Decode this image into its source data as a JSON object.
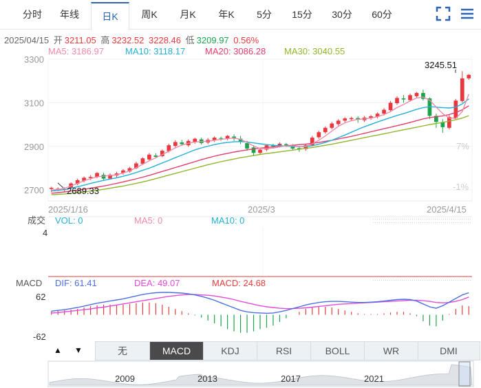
{
  "tabs": [
    "分时",
    "年线",
    "日K",
    "周K",
    "月K",
    "年K",
    "5分",
    "15分",
    "30分",
    "60分"
  ],
  "active_tab": "日K",
  "icons": {
    "fullscreen": "fullscreen-icon",
    "menu": "menu-icon"
  },
  "info": {
    "date": "2025/04/15",
    "open_label": "开",
    "open": "3211.05",
    "high_label": "高",
    "high": "3232.52",
    "close": "3228.46",
    "low_label": "低",
    "low": "3209.97",
    "change": "0.56%"
  },
  "ma_labels": {
    "ma5": "MA5: 3186.97",
    "ma10": "MA10: 3118.17",
    "ma20": "MA20: 3086.28",
    "ma30": "MA30: 3040.55"
  },
  "colors": {
    "up": "#e8383d",
    "down": "#1aa34a",
    "ma5": "#f08aa8",
    "ma10": "#22b0d6",
    "ma20": "#e23c6a",
    "ma30": "#8fb62a",
    "dif": "#4b6fe0",
    "dea": "#e04bd8",
    "grid": "#eef0f3"
  },
  "price_axis": {
    "ticks": [
      "3300",
      "3100",
      "2900",
      "2700"
    ],
    "pct_ticks": [
      "7%",
      "-1%"
    ]
  },
  "date_axis": [
    "2025/1/16",
    "2025/3",
    "2025/4/15"
  ],
  "markers": {
    "max": "3245.51",
    "min": "2689.33"
  },
  "volume": {
    "title": "成交",
    "vol": "VOL: 0",
    "ma5": "MA5: 0",
    "ma10": "MA10: 0",
    "tick": "4"
  },
  "macd": {
    "title": "MACD",
    "dif": "DIF: 61.41",
    "dea": "DEA: 49.07",
    "macd": "MACD: 24.68",
    "top": "62",
    "bottom": "-62"
  },
  "bottom_tabs": [
    "无",
    "MACD",
    "KDJ",
    "RSI",
    "BOLL",
    "WR",
    "DMI"
  ],
  "active_bottom": "MACD",
  "nav_arrows": [
    "▲",
    "▼"
  ],
  "overview_years": [
    "2009",
    "2013",
    "2017",
    "2021"
  ],
  "chart_data": {
    "type": "candlestick",
    "ylim": [
      2650,
      3300
    ],
    "candles": [
      [
        2705,
        2710,
        2690,
        2715
      ],
      [
        2702,
        2706,
        2695,
        2712
      ],
      [
        2700,
        2705,
        2689,
        2712
      ],
      [
        2710,
        2730,
        2705,
        2735
      ],
      [
        2728,
        2745,
        2722,
        2752
      ],
      [
        2742,
        2756,
        2735,
        2762
      ],
      [
        2755,
        2760,
        2746,
        2768
      ],
      [
        2760,
        2778,
        2754,
        2782
      ],
      [
        2770,
        2752,
        2745,
        2780
      ],
      [
        2752,
        2770,
        2748,
        2776
      ],
      [
        2766,
        2776,
        2758,
        2783
      ],
      [
        2778,
        2790,
        2770,
        2796
      ],
      [
        2785,
        2800,
        2780,
        2806
      ],
      [
        2800,
        2822,
        2795,
        2830
      ],
      [
        2820,
        2845,
        2815,
        2850
      ],
      [
        2840,
        2862,
        2835,
        2870
      ],
      [
        2858,
        2852,
        2845,
        2868
      ],
      [
        2855,
        2880,
        2850,
        2886
      ],
      [
        2878,
        2905,
        2872,
        2912
      ],
      [
        2902,
        2920,
        2895,
        2928
      ],
      [
        2918,
        2910,
        2902,
        2930
      ],
      [
        2905,
        2925,
        2898,
        2932
      ],
      [
        2920,
        2935,
        2912,
        2940
      ],
      [
        2932,
        2915,
        2908,
        2940
      ],
      [
        2918,
        2930,
        2910,
        2938
      ],
      [
        2928,
        2940,
        2920,
        2946
      ],
      [
        2938,
        2935,
        2926,
        2944
      ],
      [
        2935,
        2948,
        2928,
        2952
      ],
      [
        2945,
        2935,
        2925,
        2955
      ],
      [
        2935,
        2920,
        2910,
        2948
      ],
      [
        2915,
        2890,
        2880,
        2925
      ],
      [
        2895,
        2870,
        2855,
        2905
      ],
      [
        2870,
        2885,
        2862,
        2892
      ],
      [
        2885,
        2905,
        2878,
        2910
      ],
      [
        2905,
        2900,
        2892,
        2912
      ],
      [
        2900,
        2912,
        2895,
        2918
      ],
      [
        2910,
        2905,
        2898,
        2916
      ],
      [
        2900,
        2890,
        2882,
        2910
      ],
      [
        2892,
        2888,
        2875,
        2900
      ],
      [
        2888,
        2905,
        2880,
        2910
      ],
      [
        2905,
        2940,
        2900,
        2948
      ],
      [
        2942,
        2965,
        2935,
        2972
      ],
      [
        2965,
        2985,
        2958,
        2992
      ],
      [
        2985,
        3005,
        2978,
        3012
      ],
      [
        3002,
        3018,
        2995,
        3025
      ],
      [
        3018,
        3028,
        3010,
        3034
      ],
      [
        3025,
        3030,
        3018,
        3036
      ],
      [
        3030,
        3022,
        3008,
        3038
      ],
      [
        3020,
        3032,
        3012,
        3040
      ],
      [
        3030,
        3038,
        3022,
        3044
      ],
      [
        3036,
        3050,
        3028,
        3056
      ],
      [
        3050,
        3068,
        3042,
        3075
      ],
      [
        3066,
        3100,
        3060,
        3108
      ],
      [
        3098,
        3122,
        3090,
        3130
      ],
      [
        3120,
        3115,
        3100,
        3135
      ],
      [
        3112,
        3135,
        3105,
        3142
      ],
      [
        3130,
        3145,
        3122,
        3150
      ],
      [
        3145,
        3118,
        3110,
        3160
      ],
      [
        3120,
        3040,
        3025,
        3125
      ],
      [
        3040,
        3012,
        2985,
        3050
      ],
      [
        3012,
        2988,
        2962,
        3025
      ],
      [
        2985,
        3035,
        2978,
        3045
      ],
      [
        3030,
        3110,
        3025,
        3118
      ],
      [
        3108,
        3212,
        3100,
        3245
      ],
      [
        3212,
        3228,
        3205,
        3232
      ]
    ],
    "ma5": [
      2700,
      2702,
      2708,
      2718,
      2730,
      2742,
      2752,
      2760,
      2764,
      2766,
      2770,
      2778,
      2788,
      2802,
      2818,
      2834,
      2848,
      2862,
      2878,
      2893,
      2906,
      2914,
      2920,
      2922,
      2924,
      2928,
      2932,
      2936,
      2938,
      2932,
      2918,
      2902,
      2890,
      2890,
      2892,
      2898,
      2902,
      2902,
      2900,
      2900,
      2912,
      2928,
      2948,
      2970,
      2992,
      3008,
      3018,
      3024,
      3026,
      3030,
      3036,
      3046,
      3060,
      3078,
      3092,
      3108,
      3122,
      3126,
      3112,
      3080,
      3050,
      3030,
      3028,
      3060,
      3140
    ],
    "ma10": [
      2695,
      2698,
      2702,
      2708,
      2715,
      2722,
      2730,
      2737,
      2744,
      2750,
      2756,
      2763,
      2771,
      2780,
      2790,
      2800,
      2812,
      2824,
      2836,
      2848,
      2860,
      2872,
      2884,
      2893,
      2901,
      2908,
      2914,
      2918,
      2921,
      2922,
      2920,
      2916,
      2912,
      2908,
      2905,
      2903,
      2901,
      2900,
      2899,
      2899,
      2903,
      2910,
      2918,
      2928,
      2940,
      2952,
      2965,
      2978,
      2990,
      3001,
      3012,
      3022,
      3032,
      3042,
      3050,
      3060,
      3070,
      3078,
      3082,
      3080,
      3078,
      3076,
      3080,
      3095,
      3118
    ],
    "ma20": [
      2685,
      2688,
      2691,
      2695,
      2699,
      2703,
      2708,
      2713,
      2718,
      2724,
      2730,
      2737,
      2744,
      2751,
      2759,
      2767,
      2776,
      2785,
      2794,
      2803,
      2812,
      2821,
      2830,
      2839,
      2847,
      2855,
      2862,
      2868,
      2874,
      2879,
      2884,
      2888,
      2892,
      2895,
      2898,
      2900,
      2903,
      2905,
      2908,
      2910,
      2914,
      2918,
      2923,
      2928,
      2934,
      2940,
      2946,
      2953,
      2960,
      2967,
      2974,
      2981,
      2988,
      2995,
      3002,
      3010,
      3018,
      3026,
      3032,
      3036,
      3040,
      3046,
      3055,
      3068,
      3086
    ],
    "ma30": [
      2678,
      2680,
      2682,
      2685,
      2688,
      2691,
      2695,
      2699,
      2703,
      2708,
      2713,
      2718,
      2724,
      2730,
      2737,
      2744,
      2752,
      2760,
      2768,
      2776,
      2784,
      2792,
      2800,
      2808,
      2816,
      2823,
      2830,
      2836,
      2842,
      2848,
      2853,
      2858,
      2863,
      2867,
      2871,
      2875,
      2879,
      2883,
      2887,
      2891,
      2895,
      2900,
      2905,
      2910,
      2916,
      2922,
      2928,
      2934,
      2940,
      2946,
      2952,
      2958,
      2964,
      2970,
      2976,
      2982,
      2988,
      2994,
      3000,
      3005,
      3010,
      3016,
      3022,
      3030,
      3041
    ],
    "macd_ylim": [
      -62,
      62
    ],
    "dif": [
      10,
      12,
      14,
      17,
      20,
      24,
      28,
      32,
      35,
      38,
      41,
      44,
      48,
      52,
      56,
      59,
      61,
      62,
      62,
      61,
      60,
      58,
      55,
      51,
      46,
      40,
      33,
      26,
      19,
      12,
      8,
      6,
      5,
      4,
      5,
      8,
      12,
      17,
      22,
      27,
      31,
      34,
      36,
      37,
      37,
      36,
      35,
      34,
      34,
      35,
      36,
      38,
      40,
      42,
      43,
      42,
      38,
      30,
      22,
      18,
      25,
      35,
      45,
      55,
      61
    ],
    "dea": [
      5,
      6,
      8,
      10,
      12,
      14,
      16,
      19,
      21,
      24,
      27,
      30,
      33,
      36,
      39,
      42,
      45,
      48,
      51,
      53,
      55,
      56,
      56,
      55,
      54,
      52,
      49,
      46,
      42,
      37,
      33,
      29,
      25,
      22,
      20,
      18,
      17,
      17,
      18,
      19,
      21,
      23,
      25,
      27,
      29,
      30,
      31,
      32,
      33,
      34,
      35,
      36,
      37,
      38,
      39,
      40,
      40,
      39,
      37,
      34,
      33,
      34,
      37,
      42,
      49
    ],
    "macd_bar": [
      10,
      12,
      12,
      14,
      16,
      20,
      24,
      26,
      28,
      28,
      28,
      28,
      30,
      32,
      34,
      34,
      32,
      28,
      22,
      16,
      10,
      4,
      -2,
      -8,
      -16,
      -24,
      -32,
      -40,
      -46,
      -50,
      -50,
      -46,
      -40,
      -36,
      -30,
      -20,
      -10,
      0,
      8,
      16,
      20,
      22,
      22,
      20,
      16,
      12,
      8,
      4,
      2,
      2,
      2,
      4,
      6,
      8,
      8,
      4,
      -4,
      -18,
      -30,
      -32,
      -16,
      2,
      16,
      26,
      24
    ]
  }
}
